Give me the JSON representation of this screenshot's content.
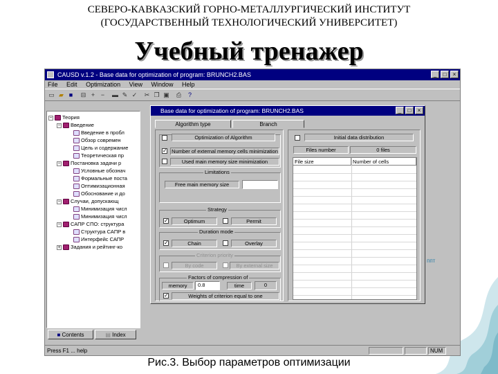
{
  "slide": {
    "header_line1": "СЕВЕРО-КАВКАЗСКИЙ ГОРНО-МЕТАЛЛУРГИЧЕСКИЙ ИНСТИТУТ",
    "header_line2": "(ГОСУДАРСТВЕННЫЙ ТЕХНОЛОГИЧЕСКИЙ УНИВЕРСИТЕТ)",
    "title": "Учебный тренажер",
    "caption": "Рис.3. Выбор параметров оптимизации",
    "side_link": "ппт"
  },
  "app": {
    "title": "CAUSD v.1.2 - Base data for optimization of program: BRUNCH2.BAS",
    "window_buttons": [
      "_",
      "□",
      "×"
    ],
    "menu": [
      "File",
      "Edit",
      "Optimization",
      "View",
      "Window",
      "Help"
    ],
    "status_left": "Press F1 ... help",
    "status_right": "NUM",
    "colors": {
      "titlebar": "#000080",
      "face": "#c0c0c0"
    }
  },
  "tree": {
    "items": [
      {
        "label": "Теория",
        "indent": 0,
        "icon": "book-icon"
      },
      {
        "label": "Введение",
        "indent": 1,
        "icon": "book-icon"
      },
      {
        "label": "Введение в пробл",
        "indent": 2,
        "icon": "page-icon"
      },
      {
        "label": "Обзор современ",
        "indent": 2,
        "icon": "page-icon"
      },
      {
        "label": "Цель и содержание",
        "indent": 2,
        "icon": "page-icon"
      },
      {
        "label": "Теоретическая пр",
        "indent": 2,
        "icon": "page-icon"
      },
      {
        "label": "Постановка задачи р",
        "indent": 1,
        "icon": "book-icon"
      },
      {
        "label": "Условные обознач",
        "indent": 2,
        "icon": "page-icon"
      },
      {
        "label": "Формальные поста",
        "indent": 2,
        "icon": "page-icon"
      },
      {
        "label": "Оптимизационная",
        "indent": 2,
        "icon": "page-icon"
      },
      {
        "label": "Обоснование и до",
        "indent": 2,
        "icon": "page-icon"
      },
      {
        "label": "Случаи, допускающ",
        "indent": 1,
        "icon": "book-icon"
      },
      {
        "label": "Минимизация числ",
        "indent": 2,
        "icon": "page-icon"
      },
      {
        "label": "Минимизация числ",
        "indent": 2,
        "icon": "page-icon"
      },
      {
        "label": "САПР СПО: структура",
        "indent": 1,
        "icon": "book-icon"
      },
      {
        "label": "Структура САПР в",
        "indent": 2,
        "icon": "page-icon"
      },
      {
        "label": "Интерфейс САПР",
        "indent": 2,
        "icon": "page-icon"
      },
      {
        "label": "Задания и рейтинг-ко",
        "indent": 0,
        "icon": "book-icon"
      }
    ],
    "tabs": [
      "Contents",
      "Index"
    ]
  },
  "dialog": {
    "title": "Base data for optimization of program: BRUNCH2.BAS",
    "tabs": [
      "Algorithm type",
      "Branch"
    ],
    "optimization_of_algorithm": "Optimization of Algorithm",
    "num_memory_cells": "Number of external memory cells minimization",
    "used_main_memory": "Used main memory size minimization",
    "limitations": "Limitations",
    "free_main_memory": "Free main memory size",
    "free_main_memory_value": "",
    "strategy": "Strategy",
    "optimum": "Optimum",
    "permit": "Permit",
    "duration_mode": "Duration mode",
    "chain": "Chain",
    "overlay": "Overlay",
    "criterion_priority": "Criterion priority",
    "by_code": "By code",
    "by_external_size": "By external size",
    "factors_of_compression": "Factors of compression of",
    "memory": "memory",
    "memory_value": "0.8",
    "time": "time",
    "time_value": "0",
    "weights_equal": "Weights of criterion equal to one",
    "initial_data_distribution": "Initial data distribution",
    "files_number": "Files number",
    "files_value": "0 files",
    "col_file_size": "File size",
    "col_num_cells": "Number of cells",
    "checks": {
      "opt_algorithm": false,
      "num_memory": true,
      "used_main": false,
      "optimum": true,
      "permit": false,
      "chain": true,
      "overlay": false,
      "by_code": false,
      "by_external": false,
      "weights": true,
      "initial": false
    }
  }
}
